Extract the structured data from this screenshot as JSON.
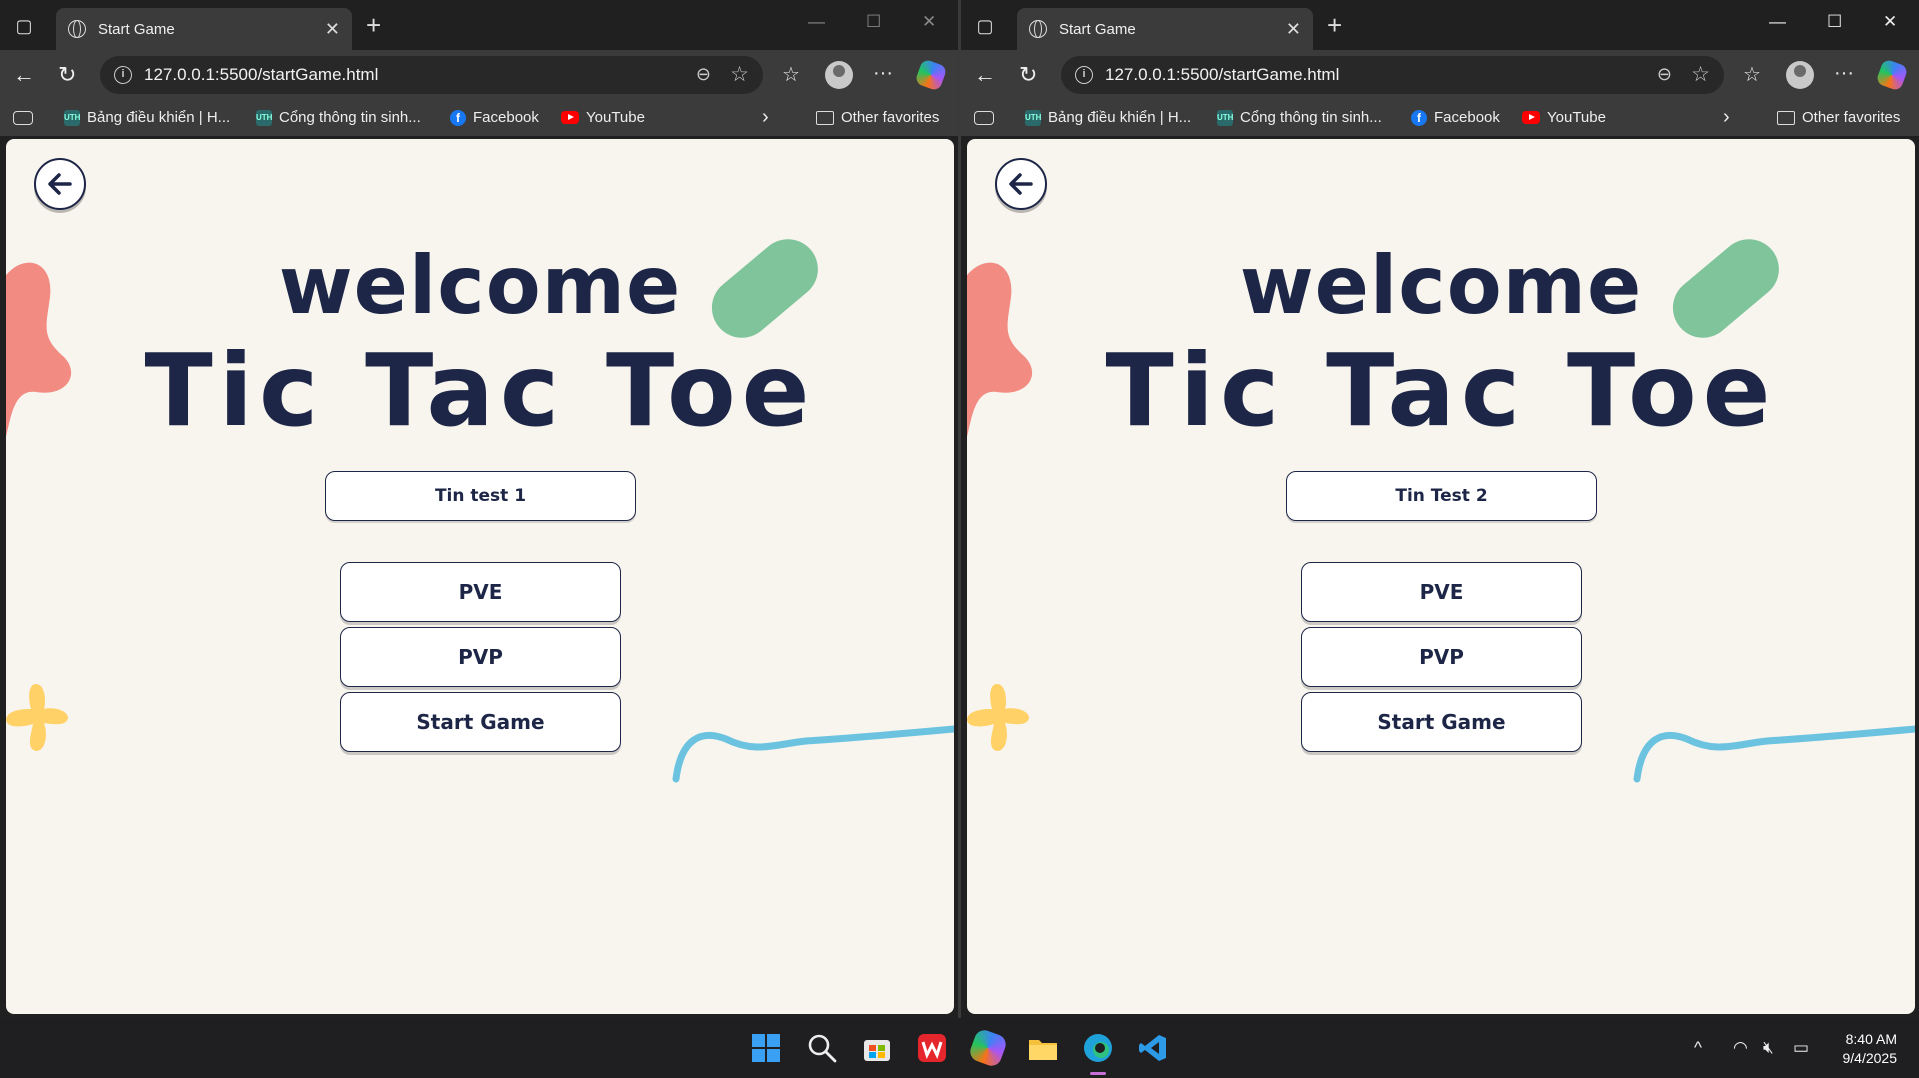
{
  "windows": [
    {
      "tab": {
        "title": "Start Game"
      },
      "toolbar": {
        "url": "127.0.0.1:5500/startGame.html"
      },
      "bookmarks": [
        {
          "label": "Bảng điều khiển | H...",
          "icon": "uth-icon"
        },
        {
          "label": "Cổng thông tin sinh...",
          "icon": "uth-icon"
        },
        {
          "label": "Facebook",
          "icon": "facebook-icon"
        },
        {
          "label": "YouTube",
          "icon": "youtube-icon"
        }
      ],
      "other_favorites": "Other favorites",
      "page": {
        "welcome": "welcome",
        "title": "Tic Tac Toe",
        "player_name": "Tin test 1",
        "buttons": {
          "pve": "PVE",
          "pvp": "PVP",
          "start": "Start Game"
        }
      }
    },
    {
      "tab": {
        "title": "Start Game"
      },
      "toolbar": {
        "url": "127.0.0.1:5500/startGame.html"
      },
      "bookmarks": [
        {
          "label": "Bảng điều khiển | H...",
          "icon": "uth-icon"
        },
        {
          "label": "Cổng thông tin sinh...",
          "icon": "uth-icon"
        },
        {
          "label": "Facebook",
          "icon": "facebook-icon"
        },
        {
          "label": "YouTube",
          "icon": "youtube-icon"
        }
      ],
      "other_favorites": "Other favorites",
      "page": {
        "welcome": "welcome",
        "title": "Tic Tac Toe",
        "player_name": "Tin Test 2",
        "buttons": {
          "pve": "PVE",
          "pvp": "PVP",
          "start": "Start Game"
        }
      }
    }
  ],
  "taskbar": {
    "apps": [
      "windows-start-icon",
      "search-icon",
      "store-icon",
      "wps-office-icon",
      "copilot-icon",
      "file-explorer-icon",
      "edge-icon",
      "vscode-icon"
    ],
    "time": "8:40 AM",
    "date": "9/4/2025"
  },
  "colors": {
    "page_bg": "#f8f5ef",
    "title": "#1d2646",
    "coral": "#f28b82",
    "green": "#7fc49a",
    "yellow": "#ffd166",
    "blue": "#6cc3e0"
  }
}
